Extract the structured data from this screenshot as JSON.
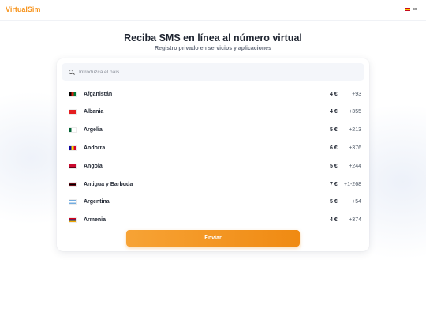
{
  "header": {
    "logo": "VirtualSim",
    "lang_label": "ES"
  },
  "hero": {
    "title": "Reciba SMS en línea al número virtual",
    "subtitle": "Registro privado en servicios y aplicaciones"
  },
  "search": {
    "placeholder": "Introduzca el país"
  },
  "countries": [
    {
      "name": "Afganistán",
      "price": "4 €",
      "code": "+93",
      "flag": "afghanistan-flag-icon",
      "colors": [
        "#000000",
        "#d32011",
        "#007a36"
      ]
    },
    {
      "name": "Albania",
      "price": "4 €",
      "code": "+355",
      "flag": "albania-flag-icon",
      "colors": [
        "#e41e20",
        "#e41e20",
        "#e41e20"
      ]
    },
    {
      "name": "Argelia",
      "price": "5 €",
      "code": "+213",
      "flag": "algeria-flag-icon",
      "colors": [
        "#006233",
        "#ffffff",
        "#ffffff"
      ]
    },
    {
      "name": "Andorra",
      "price": "6 €",
      "code": "+376",
      "flag": "andorra-flag-icon",
      "colors": [
        "#10069f",
        "#fedd00",
        "#d50032"
      ]
    },
    {
      "name": "Angola",
      "price": "5 €",
      "code": "+244",
      "flag": "angola-flag-icon",
      "colors": [
        "#cc092f",
        "#cc092f",
        "#000000"
      ]
    },
    {
      "name": "Antigua y Barbuda",
      "price": "7 €",
      "code": "+1-268",
      "flag": "antigua-flag-icon",
      "colors": [
        "#ce1126",
        "#000000",
        "#ce1126"
      ]
    },
    {
      "name": "Argentina",
      "price": "5 €",
      "code": "+54",
      "flag": "argentina-flag-icon",
      "colors": [
        "#74acdf",
        "#ffffff",
        "#74acdf"
      ]
    },
    {
      "name": "Armenia",
      "price": "4 €",
      "code": "+374",
      "flag": "armenia-flag-icon",
      "colors": [
        "#d90012",
        "#0033a0",
        "#f2a800"
      ]
    }
  ],
  "actions": {
    "send_label": "Enviar"
  }
}
